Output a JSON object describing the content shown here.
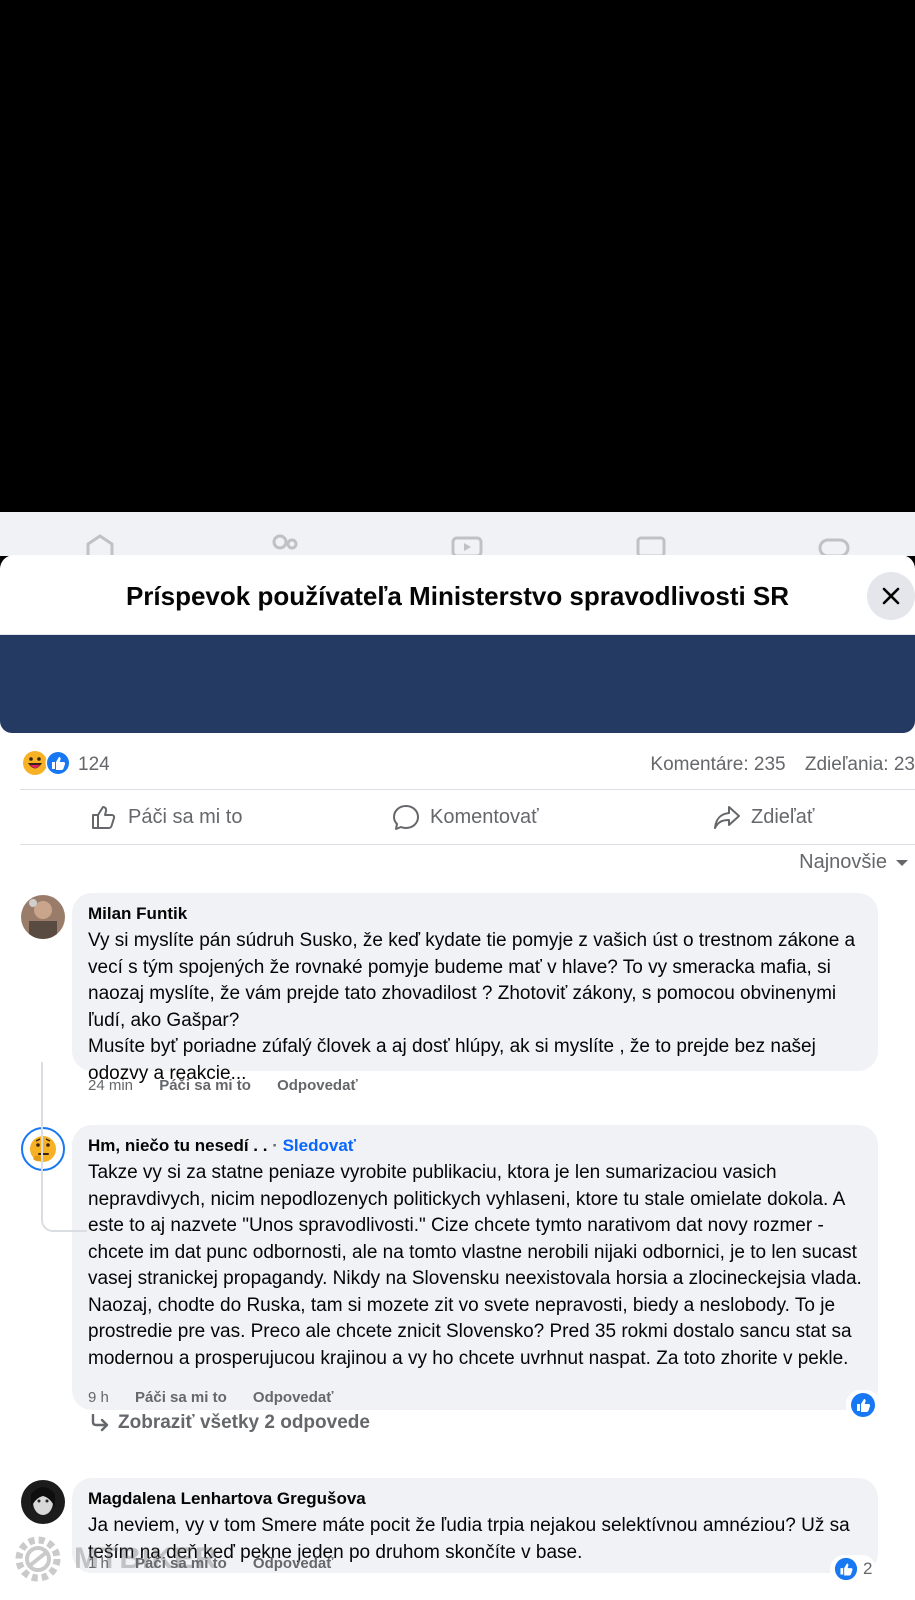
{
  "modal": {
    "title": "Príspevok používateľa Ministerstvo spravodlivosti SR"
  },
  "stats": {
    "reaction_count": "124",
    "comments": "Komentáre: 235",
    "shares": "Zdieľania: 23"
  },
  "actions": {
    "like": "Páči sa mi to",
    "comment": "Komentovať",
    "share": "Zdieľať"
  },
  "sort": {
    "label": "Najnovšie"
  },
  "comments": [
    {
      "author": "Milan Funtik",
      "text": "Vy si myslíte pán súdruh Susko, že keď kydate tie pomyje z vašich úst o trestnom zákone a vecí s tým spojených že rovnaké pomyje budeme mať v hlave? To vy smeracka mafia, si naozaj myslíte, že vám prejde tato zhovadilost ? Zhotoviť zákony, s pomocou obvinenymi ľudí, ako Gašpar?\nMusíte byť poriadne zúfalý človek a aj dosť hlúpy, ak si myslíte , že to prejde bez našej odozvy a reakcie...",
      "time": "24 min",
      "like_label": "Páči sa mi to",
      "reply_label": "Odpovedať"
    },
    {
      "author": "Hm, niečo tu nesedí . .",
      "follow_sep": " · ",
      "follow": "Sledovať",
      "text": "Takze vy si za statne peniaze vyrobite publikaciu, ktora je len sumarizaciou vasich nepravdivych, nicim nepodlozenych politickych vyhlaseni, ktore tu stale omielate dokola. A este to aj nazvete \"Unos spravodlivosti.\" Cize chcete tymto narativom dat novy rozmer - chcete im dat punc odbornosti, ale na tomto vlastne nerobili nijaki odbornici, je to len sucast vasej stranickej propagandy. Nikdy na Slovensku neexistovala horsia a zlocineckejsia vlada. Naozaj, chodte do Ruska, tam si mozete zit vo svete nepravosti, biedy a neslobody. To je prostredie pre vas. Preco ale chcete znicit Slovensko? Pred 35 rokmi dostalo sancu stat sa modernou a prosperujucou krajinou a vy ho chcete uvrhnut naspat. Za toto zhorite v pekle.",
      "time": "9 h",
      "like_label": "Páči sa mi to",
      "reply_label": "Odpovedať",
      "view_replies": "Zobraziť všetky 2 odpovede"
    },
    {
      "author": "Magdalena Lenhartova Gregušova",
      "text": "Ja neviem, vy v tom Smere máte pocit že ľudia trpia nejakou selektívnou amnéziou? Už sa teším na deň keď pekne jeden po druhom skončíte v base.",
      "time": "1 h",
      "like_label": "Páči sa mi to",
      "reply_label": "Odpovedať",
      "likes": "2"
    }
  ],
  "watermark": {
    "text": "MTBIKER"
  },
  "colors": {
    "accent": "#0866ff",
    "banner": "#253a62",
    "bubble": "#f0f2f5",
    "secondary_text": "#65676b"
  }
}
